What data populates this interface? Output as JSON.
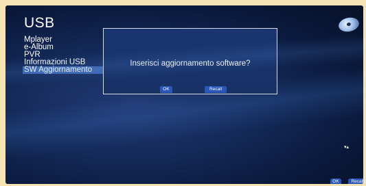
{
  "screen": {
    "title": "USB"
  },
  "menu": {
    "items": [
      {
        "label": "Mplayer",
        "selected": false
      },
      {
        "label": "e-Album",
        "selected": false
      },
      {
        "label": "PVR",
        "selected": false
      },
      {
        "label": "Informazioni USB",
        "selected": false
      },
      {
        "label": "SW Aggiornamento",
        "selected": true
      }
    ]
  },
  "dialog": {
    "message": "Inserisci aggiornamento software?",
    "ok_label": "OK",
    "recall_label": "Recall"
  },
  "scroll": {
    "indicator": "▾▴"
  },
  "footer": {
    "ok_label": "OK",
    "recall_label": "Recall"
  },
  "colors": {
    "background_deep": "#0a1a3d",
    "selection": "#3f68b4",
    "button": "#2b57b8",
    "outer_bg": "#f6e3b4"
  },
  "icons": {
    "top_right": "disc-icon"
  }
}
